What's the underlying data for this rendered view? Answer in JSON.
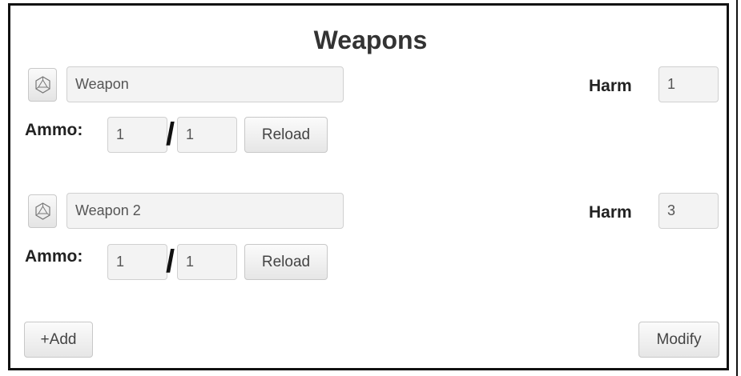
{
  "title": "Weapons",
  "weapons": [
    {
      "dice_icon": "d20-dice-icon",
      "name": "Weapon",
      "harm_label": "Harm",
      "harm": "1",
      "ammo_label": "Ammo:",
      "ammo_current": "1",
      "ammo_separator": "/",
      "ammo_max": "1",
      "reload_label": "Reload"
    },
    {
      "dice_icon": "d20-dice-icon",
      "name": "Weapon 2",
      "harm_label": "Harm",
      "harm": "3",
      "ammo_label": "Ammo:",
      "ammo_current": "1",
      "ammo_separator": "/",
      "ammo_max": "1",
      "reload_label": "Reload"
    }
  ],
  "footer": {
    "add_label": "+Add",
    "modify_label": "Modify"
  }
}
